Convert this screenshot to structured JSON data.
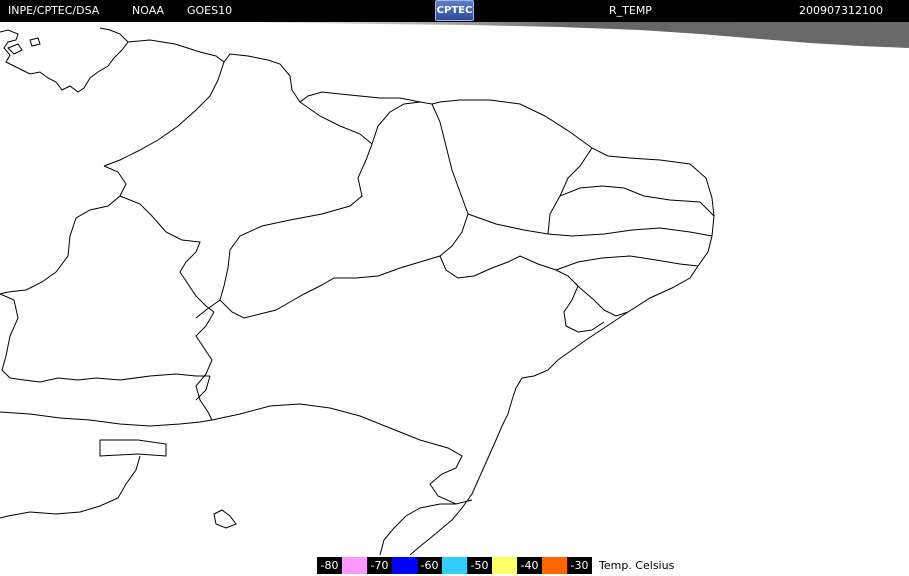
{
  "header": {
    "organization": "INPE/CPTEC/DSA",
    "agency": "NOAA",
    "satellite": "GOES10",
    "logo_text": "CPTEC",
    "product": "R_TEMP",
    "datetime": "200907312100"
  },
  "map": {
    "background_color": "#ffffff",
    "boundary_color": "#000000"
  },
  "legend": {
    "items": [
      {
        "label": "-80",
        "color": "#ff99ff"
      },
      {
        "label": "-70",
        "color": "#0000ff"
      },
      {
        "label": "-60",
        "color": "#33ccff"
      },
      {
        "label": "-50",
        "color": "#ffff66"
      },
      {
        "label": "-40",
        "color": "#ff6600"
      },
      {
        "label": "-30",
        "color": null
      }
    ],
    "units": "Temp. Celsius"
  }
}
